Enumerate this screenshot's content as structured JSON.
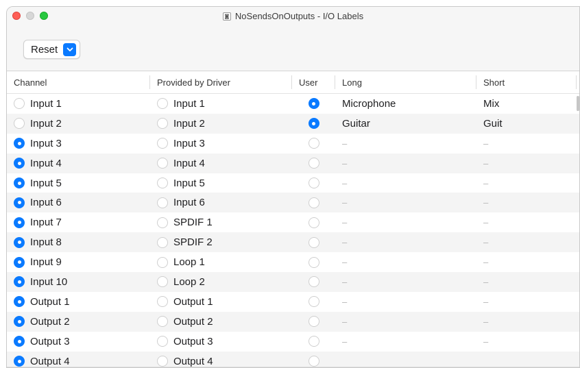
{
  "window": {
    "title": "NoSendsOnOutputs - I/O Labels"
  },
  "toolbar": {
    "reset_label": "Reset"
  },
  "columns": [
    "Channel",
    "Provided by Driver",
    "User",
    "Long",
    "Short"
  ],
  "rows": [
    {
      "channel": "Input 1",
      "channel_selected": false,
      "driver": "Input 1",
      "user_selected": true,
      "long": "Microphone",
      "short": "Mix"
    },
    {
      "channel": "Input 2",
      "channel_selected": false,
      "driver": "Input 2",
      "user_selected": true,
      "long": "Guitar",
      "short": "Guit"
    },
    {
      "channel": "Input 3",
      "channel_selected": true,
      "driver": "Input 3",
      "user_selected": false,
      "long": "–",
      "short": "–"
    },
    {
      "channel": "Input 4",
      "channel_selected": true,
      "driver": "Input 4",
      "user_selected": false,
      "long": "–",
      "short": "–"
    },
    {
      "channel": "Input 5",
      "channel_selected": true,
      "driver": "Input 5",
      "user_selected": false,
      "long": "–",
      "short": "–"
    },
    {
      "channel": "Input 6",
      "channel_selected": true,
      "driver": "Input 6",
      "user_selected": false,
      "long": "–",
      "short": "–"
    },
    {
      "channel": "Input 7",
      "channel_selected": true,
      "driver": "SPDIF 1",
      "user_selected": false,
      "long": "–",
      "short": "–"
    },
    {
      "channel": "Input 8",
      "channel_selected": true,
      "driver": "SPDIF 2",
      "user_selected": false,
      "long": "–",
      "short": "–"
    },
    {
      "channel": "Input 9",
      "channel_selected": true,
      "driver": "Loop 1",
      "user_selected": false,
      "long": "–",
      "short": "–"
    },
    {
      "channel": "Input 10",
      "channel_selected": true,
      "driver": "Loop 2",
      "user_selected": false,
      "long": "–",
      "short": "–"
    },
    {
      "channel": "Output 1",
      "channel_selected": true,
      "driver": "Output 1",
      "user_selected": false,
      "long": "–",
      "short": "–"
    },
    {
      "channel": "Output 2",
      "channel_selected": true,
      "driver": "Output 2",
      "user_selected": false,
      "long": "–",
      "short": "–"
    },
    {
      "channel": "Output 3",
      "channel_selected": true,
      "driver": "Output 3",
      "user_selected": false,
      "long": "–",
      "short": "–"
    },
    {
      "channel": "Output 4",
      "channel_selected": true,
      "driver": "Output 4",
      "user_selected": false,
      "long": "",
      "short": ""
    }
  ],
  "colors": {
    "accent": "#0a7aff",
    "row_alt": "#f4f4f4"
  },
  "icons": {
    "title_icon": "document-icon",
    "reset_dropdown": "chevron-down-icon"
  }
}
